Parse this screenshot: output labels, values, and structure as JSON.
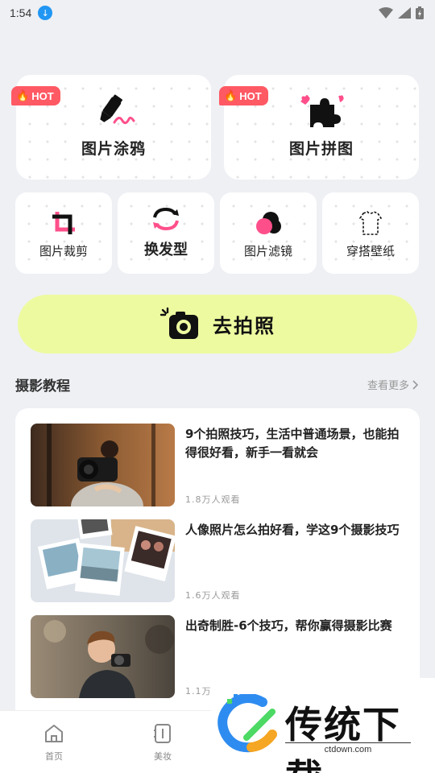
{
  "status_bar": {
    "time": "1:54"
  },
  "features": {
    "hot_badge": "HOT",
    "big": [
      {
        "label": "图片涂鸦",
        "icon": "marker-scribble-icon",
        "hot": true
      },
      {
        "label": "图片拼图",
        "icon": "puzzle-hearts-icon",
        "hot": true
      }
    ],
    "small": [
      {
        "label": "图片裁剪",
        "icon": "crop-icon"
      },
      {
        "label": "换发型",
        "icon": "refresh-arrows-icon"
      },
      {
        "label": "图片滤镜",
        "icon": "filter-circles-icon"
      },
      {
        "label": "穿搭壁纸",
        "icon": "tshirt-icon"
      }
    ]
  },
  "cta": {
    "label": "去拍照",
    "icon": "camera-icon"
  },
  "section": {
    "title": "摄影教程",
    "more": "查看更多"
  },
  "tutorials": [
    {
      "title": "9个拍照技巧，生活中普通场景，也能拍得很好看，新手一看就会",
      "views": "1.8万人观看",
      "image": "photographer-camera-photo"
    },
    {
      "title": "人像照片怎么拍好看，学这9个摄影技巧",
      "views": "1.6万人观看",
      "image": "polaroid-prints-photo"
    },
    {
      "title": "出奇制胜-6个技巧，帮你赢得摄影比赛",
      "views": "1.1万",
      "image": "child-camera-photo"
    }
  ],
  "tabbar": [
    {
      "label": "首页",
      "icon": "home-icon"
    },
    {
      "label": "美妆",
      "icon": "makeup-icon"
    }
  ],
  "watermark": {
    "text": "传统下载",
    "url": "ctdown.com"
  },
  "colors": {
    "accent_cta": "#eefaa0",
    "hot": "#ff5964",
    "pink": "#ff4f8b",
    "background": "#eef0f4"
  }
}
